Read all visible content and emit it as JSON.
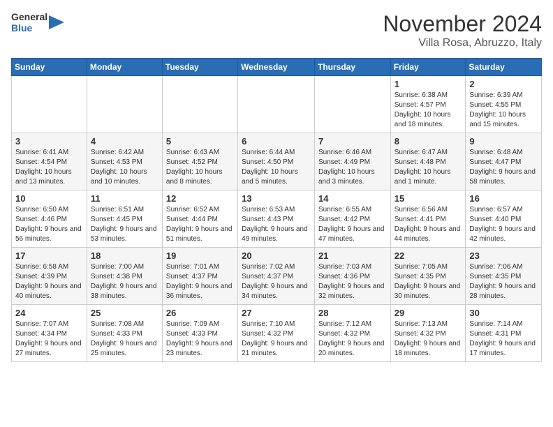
{
  "header": {
    "logo_general": "General",
    "logo_blue": "Blue",
    "month_title": "November 2024",
    "location": "Villa Rosa, Abruzzo, Italy"
  },
  "weekdays": [
    "Sunday",
    "Monday",
    "Tuesday",
    "Wednesday",
    "Thursday",
    "Friday",
    "Saturday"
  ],
  "weeks": [
    [
      {
        "day": "",
        "info": ""
      },
      {
        "day": "",
        "info": ""
      },
      {
        "day": "",
        "info": ""
      },
      {
        "day": "",
        "info": ""
      },
      {
        "day": "",
        "info": ""
      },
      {
        "day": "1",
        "info": "Sunrise: 6:38 AM\nSunset: 4:57 PM\nDaylight: 10 hours and 18 minutes."
      },
      {
        "day": "2",
        "info": "Sunrise: 6:39 AM\nSunset: 4:55 PM\nDaylight: 10 hours and 15 minutes."
      }
    ],
    [
      {
        "day": "3",
        "info": "Sunrise: 6:41 AM\nSunset: 4:54 PM\nDaylight: 10 hours and 13 minutes."
      },
      {
        "day": "4",
        "info": "Sunrise: 6:42 AM\nSunset: 4:53 PM\nDaylight: 10 hours and 10 minutes."
      },
      {
        "day": "5",
        "info": "Sunrise: 6:43 AM\nSunset: 4:52 PM\nDaylight: 10 hours and 8 minutes."
      },
      {
        "day": "6",
        "info": "Sunrise: 6:44 AM\nSunset: 4:50 PM\nDaylight: 10 hours and 5 minutes."
      },
      {
        "day": "7",
        "info": "Sunrise: 6:46 AM\nSunset: 4:49 PM\nDaylight: 10 hours and 3 minutes."
      },
      {
        "day": "8",
        "info": "Sunrise: 6:47 AM\nSunset: 4:48 PM\nDaylight: 10 hours and 1 minute."
      },
      {
        "day": "9",
        "info": "Sunrise: 6:48 AM\nSunset: 4:47 PM\nDaylight: 9 hours and 58 minutes."
      }
    ],
    [
      {
        "day": "10",
        "info": "Sunrise: 6:50 AM\nSunset: 4:46 PM\nDaylight: 9 hours and 56 minutes."
      },
      {
        "day": "11",
        "info": "Sunrise: 6:51 AM\nSunset: 4:45 PM\nDaylight: 9 hours and 53 minutes."
      },
      {
        "day": "12",
        "info": "Sunrise: 6:52 AM\nSunset: 4:44 PM\nDaylight: 9 hours and 51 minutes."
      },
      {
        "day": "13",
        "info": "Sunrise: 6:53 AM\nSunset: 4:43 PM\nDaylight: 9 hours and 49 minutes."
      },
      {
        "day": "14",
        "info": "Sunrise: 6:55 AM\nSunset: 4:42 PM\nDaylight: 9 hours and 47 minutes."
      },
      {
        "day": "15",
        "info": "Sunrise: 6:56 AM\nSunset: 4:41 PM\nDaylight: 9 hours and 44 minutes."
      },
      {
        "day": "16",
        "info": "Sunrise: 6:57 AM\nSunset: 4:40 PM\nDaylight: 9 hours and 42 minutes."
      }
    ],
    [
      {
        "day": "17",
        "info": "Sunrise: 6:58 AM\nSunset: 4:39 PM\nDaylight: 9 hours and 40 minutes."
      },
      {
        "day": "18",
        "info": "Sunrise: 7:00 AM\nSunset: 4:38 PM\nDaylight: 9 hours and 38 minutes."
      },
      {
        "day": "19",
        "info": "Sunrise: 7:01 AM\nSunset: 4:37 PM\nDaylight: 9 hours and 36 minutes."
      },
      {
        "day": "20",
        "info": "Sunrise: 7:02 AM\nSunset: 4:37 PM\nDaylight: 9 hours and 34 minutes."
      },
      {
        "day": "21",
        "info": "Sunrise: 7:03 AM\nSunset: 4:36 PM\nDaylight: 9 hours and 32 minutes."
      },
      {
        "day": "22",
        "info": "Sunrise: 7:05 AM\nSunset: 4:35 PM\nDaylight: 9 hours and 30 minutes."
      },
      {
        "day": "23",
        "info": "Sunrise: 7:06 AM\nSunset: 4:35 PM\nDaylight: 9 hours and 28 minutes."
      }
    ],
    [
      {
        "day": "24",
        "info": "Sunrise: 7:07 AM\nSunset: 4:34 PM\nDaylight: 9 hours and 27 minutes."
      },
      {
        "day": "25",
        "info": "Sunrise: 7:08 AM\nSunset: 4:33 PM\nDaylight: 9 hours and 25 minutes."
      },
      {
        "day": "26",
        "info": "Sunrise: 7:09 AM\nSunset: 4:33 PM\nDaylight: 9 hours and 23 minutes."
      },
      {
        "day": "27",
        "info": "Sunrise: 7:10 AM\nSunset: 4:32 PM\nDaylight: 9 hours and 21 minutes."
      },
      {
        "day": "28",
        "info": "Sunrise: 7:12 AM\nSunset: 4:32 PM\nDaylight: 9 hours and 20 minutes."
      },
      {
        "day": "29",
        "info": "Sunrise: 7:13 AM\nSunset: 4:32 PM\nDaylight: 9 hours and 18 minutes."
      },
      {
        "day": "30",
        "info": "Sunrise: 7:14 AM\nSunset: 4:31 PM\nDaylight: 9 hours and 17 minutes."
      }
    ]
  ]
}
